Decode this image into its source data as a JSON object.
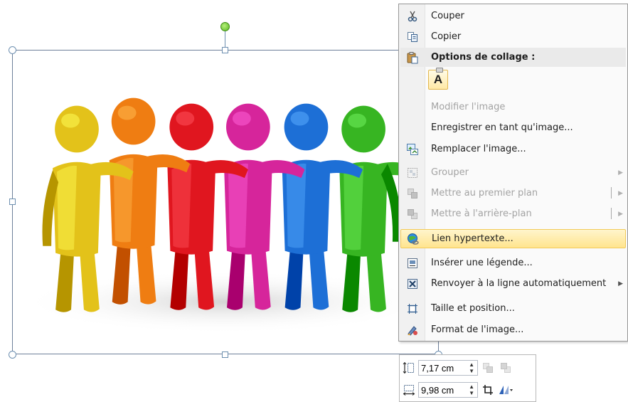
{
  "context_menu": {
    "items": [
      {
        "label": "Couper",
        "icon": "scissors-icon",
        "state": "enabled"
      },
      {
        "label": "Copier",
        "icon": "copy-icon",
        "state": "enabled"
      },
      {
        "label": "Options de collage :",
        "icon": "clipboard-icon",
        "state": "header"
      },
      {
        "label": "Modifier l'image",
        "icon": "",
        "state": "disabled"
      },
      {
        "label": "Enregistrer en tant qu'image...",
        "icon": "",
        "state": "enabled"
      },
      {
        "label": "Remplacer l'image...",
        "icon": "replace-image-icon",
        "state": "enabled"
      },
      {
        "label": "Grouper",
        "icon": "group-icon",
        "state": "disabled",
        "submenu": true
      },
      {
        "label": "Mettre au premier plan",
        "icon": "bring-forward-icon",
        "state": "disabled",
        "submenu": true
      },
      {
        "label": "Mettre à l'arrière-plan",
        "icon": "send-backward-icon",
        "state": "disabled",
        "submenu": true
      },
      {
        "label": "Lien hypertexte...",
        "icon": "hyperlink-globe-icon",
        "state": "highlighted"
      },
      {
        "label": "Insérer une légende...",
        "icon": "caption-icon",
        "state": "enabled"
      },
      {
        "label": "Renvoyer à la ligne automatiquement",
        "icon": "wrap-text-icon",
        "state": "enabled",
        "submenu": true
      },
      {
        "label": "Taille et position...",
        "icon": "size-position-icon",
        "state": "enabled"
      },
      {
        "label": "Format de l'image...",
        "icon": "format-picture-icon",
        "state": "enabled"
      }
    ],
    "paste_option_glyph": "A"
  },
  "size_toolbar": {
    "height_value": "7,17 cm",
    "width_value": "9,98 cm"
  },
  "colors": {
    "highlight": "#ffe48e",
    "figures": [
      "#e3c21a",
      "#ef7d12",
      "#e0161f",
      "#d6259b",
      "#1d6fd6",
      "#37b522"
    ]
  }
}
